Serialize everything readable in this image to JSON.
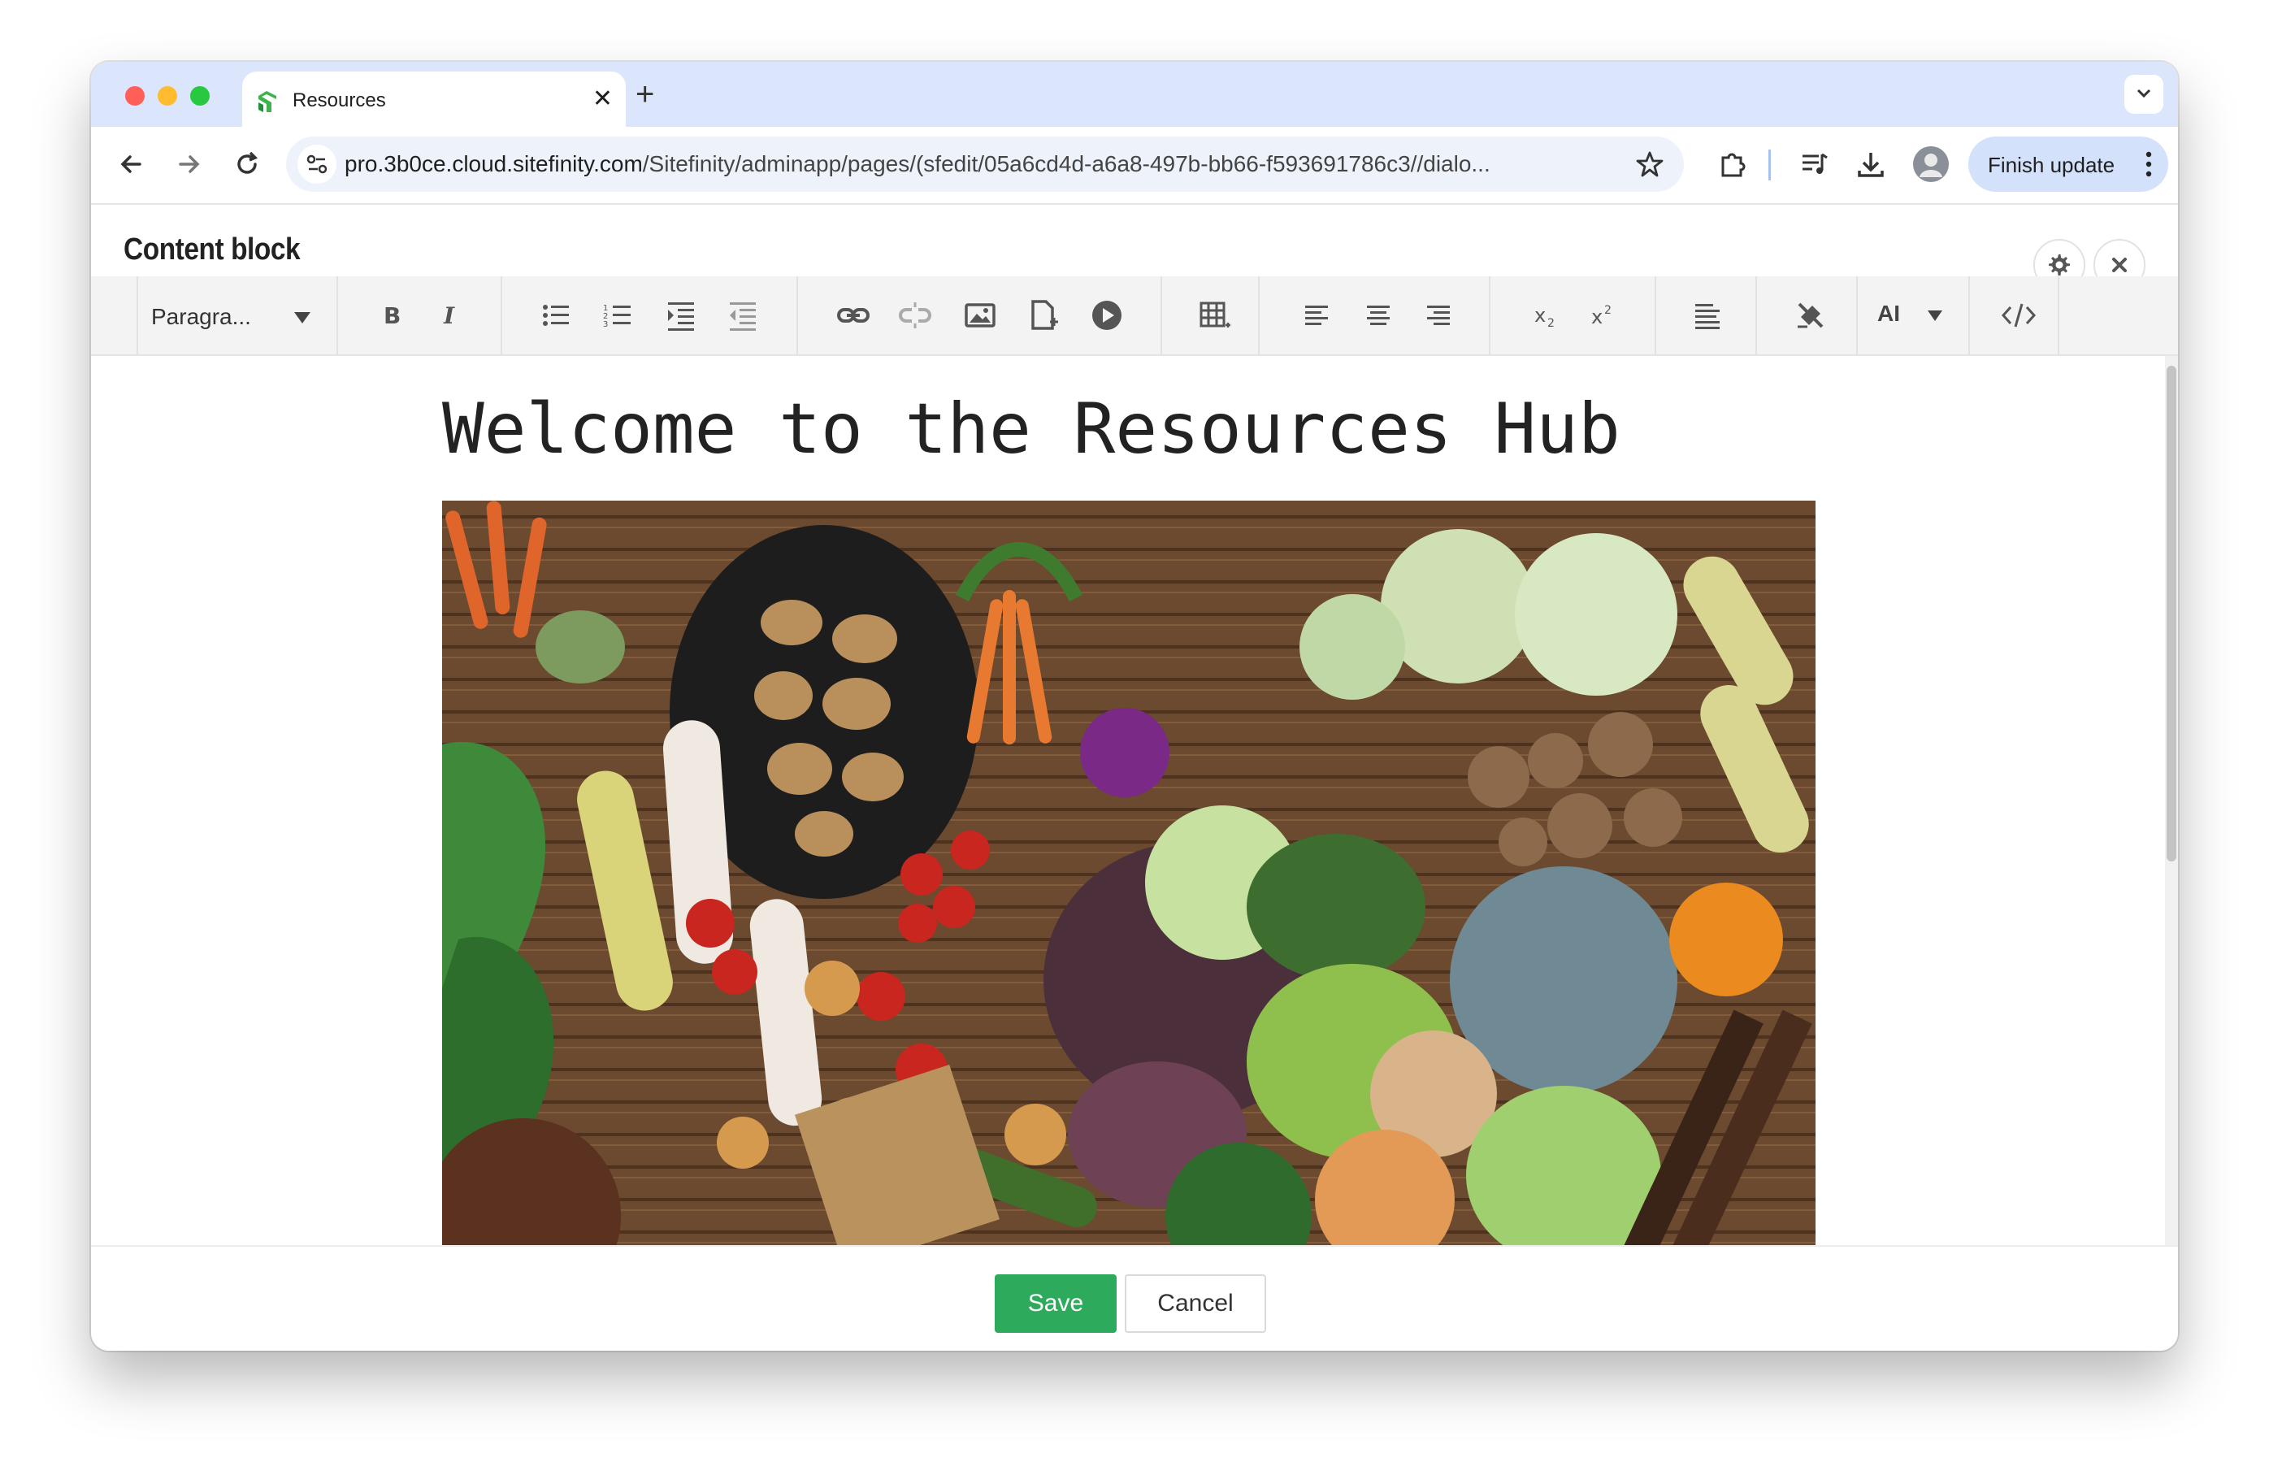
{
  "browser": {
    "tab": {
      "title": "Resources",
      "favicon": "sitefinity-logo-icon"
    },
    "url": {
      "host": "pro.3b0ce.cloud.sitefinity.com",
      "path": "/Sitefinity/adminapp/pages/(sfedit/05a6cd4d-a6a8-497b-bb66-f593691786c3//dialo..."
    },
    "finish_update_label": "Finish update"
  },
  "dialog": {
    "title": "Content block",
    "toolbar": {
      "paragraph_select": "Paragra...",
      "ai_label": "AI"
    },
    "content": {
      "heading": "Welcome to the Resources Hub",
      "image_alt": "Assorted fresh vegetables on a wooden table"
    },
    "footer": {
      "save_label": "Save",
      "cancel_label": "Cancel"
    }
  },
  "colors": {
    "tabbar_bg": "#dbe5fb",
    "save_green": "#2eaa5c",
    "finish_btn_bg": "#d4e1fb"
  }
}
